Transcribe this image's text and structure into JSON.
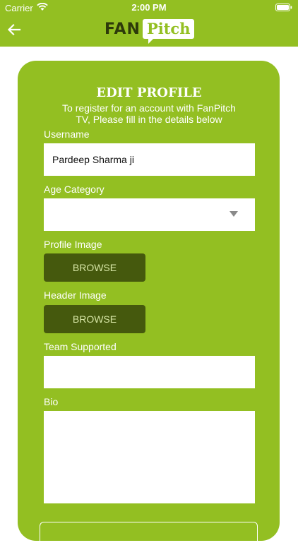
{
  "status_bar": {
    "carrier": "Carrier",
    "time": "2:00 PM"
  },
  "header": {
    "back_icon": "arrow-left-icon",
    "logo_fan": "FAN",
    "logo_pitch": "Pitch"
  },
  "form": {
    "title": "EDIT PROFILE",
    "subtitle": "To register for an account with FanPitch TV, Please fill in the details below",
    "username_label": "Username",
    "username_value": "Pardeep Sharma ji",
    "age_label": "Age Category",
    "age_value": "",
    "profile_image_label": "Profile Image",
    "profile_browse": "BROWSE",
    "header_image_label": "Header Image",
    "header_browse": "BROWSE",
    "team_label": "Team Supported",
    "team_value": "",
    "bio_label": "Bio",
    "bio_value": ""
  },
  "colors": {
    "brand_green": "#93bf22",
    "dark_green": "#45590d"
  }
}
